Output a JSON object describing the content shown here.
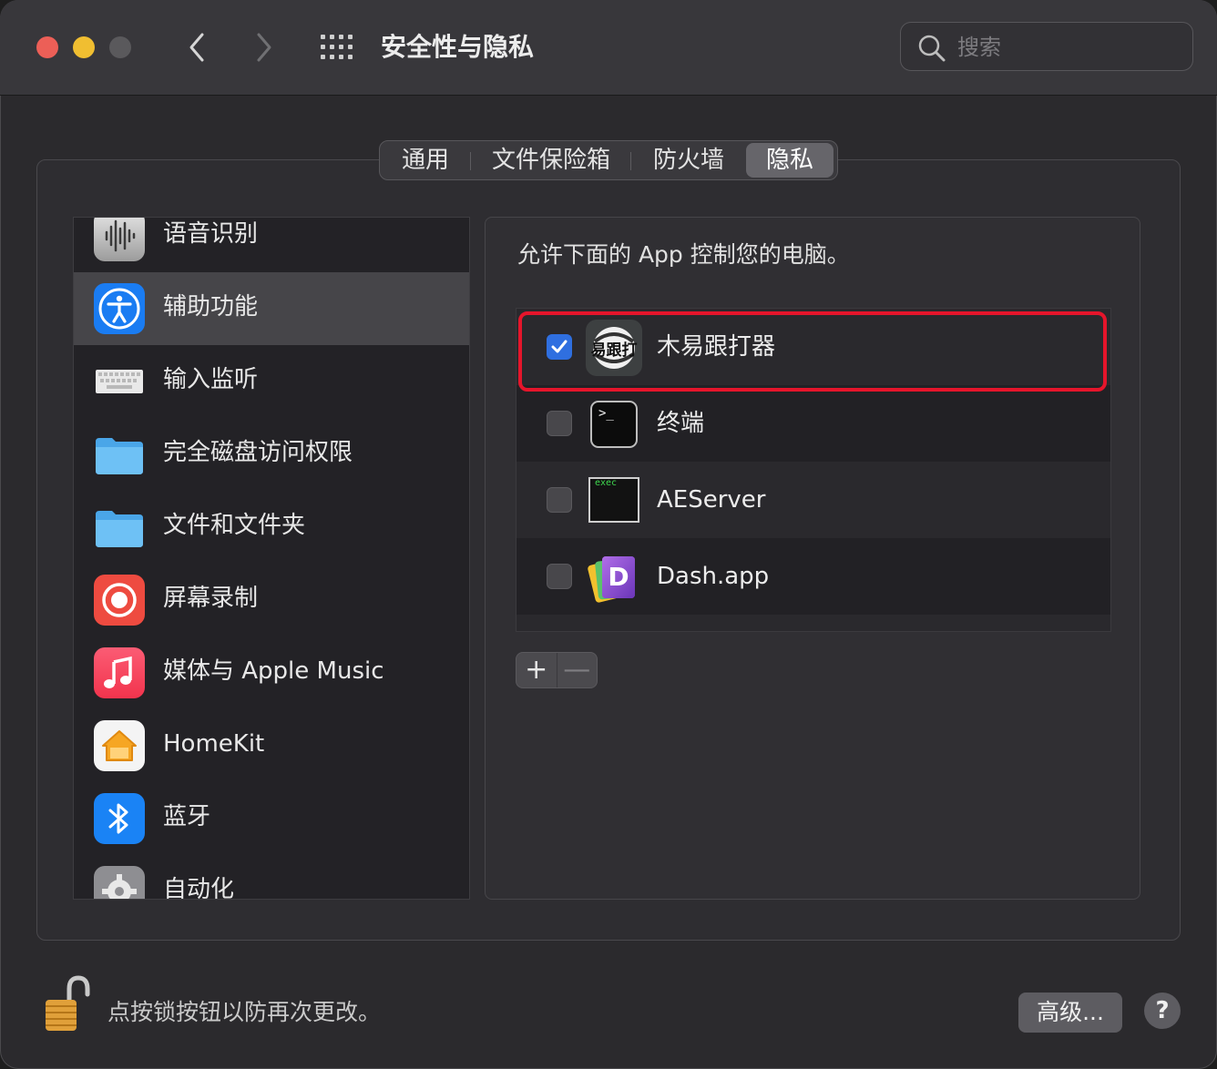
{
  "window": {
    "title": "安全性与隐私"
  },
  "search": {
    "placeholder": "搜索"
  },
  "tabs": [
    {
      "label": "通用",
      "active": false
    },
    {
      "label": "文件保险箱",
      "active": false
    },
    {
      "label": "防火墙",
      "active": false
    },
    {
      "label": "隐私",
      "active": true
    }
  ],
  "sidebar": {
    "items": [
      {
        "label": "语音识别",
        "icon": "waveform-icon"
      },
      {
        "label": "辅助功能",
        "icon": "accessibility-icon",
        "selected": true
      },
      {
        "label": "输入监听",
        "icon": "keyboard-icon"
      },
      {
        "label": "完全磁盘访问权限",
        "icon": "folder-icon"
      },
      {
        "label": "文件和文件夹",
        "icon": "folder-icon"
      },
      {
        "label": "屏幕录制",
        "icon": "screen-record-icon"
      },
      {
        "label": "媒体与 Apple Music",
        "icon": "music-icon"
      },
      {
        "label": "HomeKit",
        "icon": "home-icon"
      },
      {
        "label": "蓝牙",
        "icon": "bluetooth-icon"
      },
      {
        "label": "自动化",
        "icon": "gear-icon"
      }
    ]
  },
  "panel": {
    "description": "允许下面的 App 控制您的电脑。",
    "apps": [
      {
        "name": "木易跟打器",
        "checked": true,
        "icon_text": "易跟打"
      },
      {
        "name": "终端",
        "checked": false,
        "icon_text": ">_"
      },
      {
        "name": "AEServer",
        "checked": false,
        "icon_text": "exec"
      },
      {
        "name": "Dash.app",
        "checked": false,
        "icon_text": "D"
      }
    ],
    "add_label": "+",
    "remove_label": "—"
  },
  "footer": {
    "lock_text": "点按锁按钮以防再次更改。",
    "advanced_label": "高级...",
    "help_label": "?"
  },
  "colors": {
    "accent": "#2f6fe0",
    "highlight": "#e5152b",
    "close": "#ec5f57",
    "minimize": "#f0be31"
  }
}
